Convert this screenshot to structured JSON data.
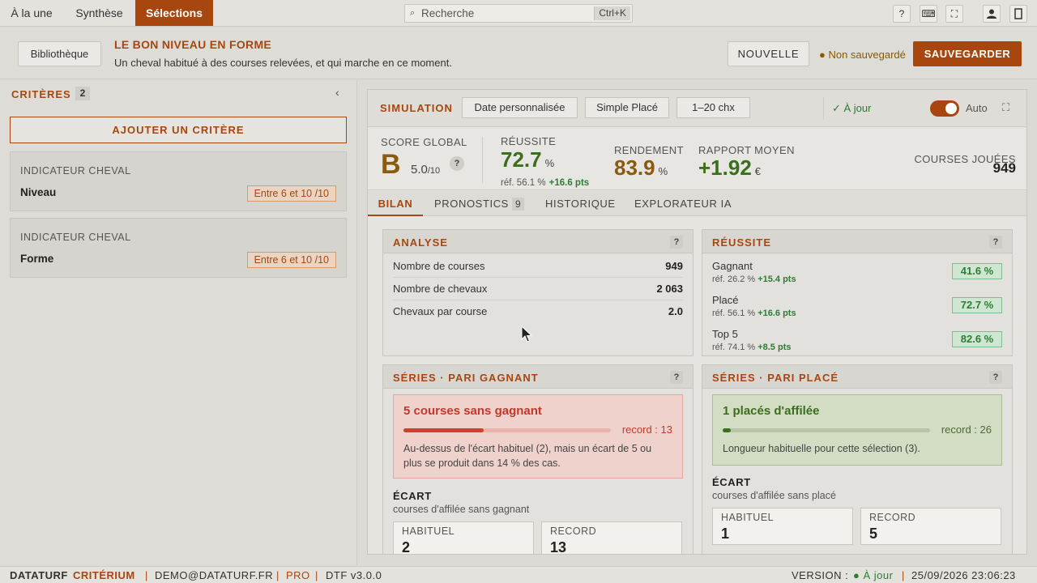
{
  "topbar": {
    "tabs": [
      {
        "label": "À la une"
      },
      {
        "label": "Synthèse"
      },
      {
        "label": "Sélections"
      }
    ],
    "search": {
      "placeholder": "Recherche",
      "shortcut": "Ctrl+K"
    },
    "icons": [
      "help-icon",
      "keyboard-icon",
      "fullscreen-icon",
      "user-icon",
      "panel-icon"
    ]
  },
  "header": {
    "library_label": "Bibliothèque",
    "title": "LE BON NIVEAU EN FORME",
    "description": "Un cheval habitué à des courses relevées, et qui marche en ce moment.",
    "new_label": "NOUVELLE",
    "unsaved": "● Non sauvegardé",
    "save_label": "SAUVEGARDER"
  },
  "sidebar": {
    "title": "CRITÈRES",
    "count": "2",
    "add_label": "AJOUTER UN CRITÈRE",
    "criteria": [
      {
        "category": "INDICATEUR CHEVAL",
        "name": "Niveau",
        "range": "Entre 6 et 10 /10"
      },
      {
        "category": "INDICATEUR CHEVAL",
        "name": "Forme",
        "range": "Entre 6 et 10 /10"
      }
    ]
  },
  "simulation": {
    "label": "SIMULATION",
    "date_label": "Date personnalisée",
    "bet_label": "Simple Placé",
    "runners_label": "1–20 chx",
    "status": "✓ À jour",
    "auto_label": "Auto",
    "auto_on": true
  },
  "scores": {
    "global_label": "SCORE GLOBAL",
    "grade": "B",
    "grade_value": "5.0",
    "grade_max": "/10",
    "reussite_label": "RÉUSSITE",
    "reussite_value": "72.7",
    "reussite_unit": "%",
    "reussite_ref": "réf. 56.1 %",
    "reussite_delta": "+16.6 pts",
    "rendement_label": "RENDEMENT",
    "rendement_value": "83.9",
    "rendement_unit": "%",
    "rapport_label": "RAPPORT MOYEN",
    "rapport_value": "+1.92",
    "rapport_unit": "€",
    "courses_label": "COURSES JOUÉES",
    "courses_value": "949"
  },
  "tabs": [
    {
      "label": "BILAN"
    },
    {
      "label": "PRONOSTICS",
      "badge": "9"
    },
    {
      "label": "HISTORIQUE"
    },
    {
      "label": "EXPLORATEUR IA"
    }
  ],
  "analyse": {
    "title": "ANALYSE",
    "rows": [
      {
        "label": "Nombre de courses",
        "value": "949"
      },
      {
        "label": "Nombre de chevaux",
        "value": "2 063"
      },
      {
        "label": "Chevaux par course",
        "value": "2.0"
      }
    ]
  },
  "reussite": {
    "title": "RÉUSSITE",
    "rows": [
      {
        "label": "Gagnant",
        "ref": "réf. 26.2 %",
        "delta": "+15.4 pts",
        "value": "41.6 %"
      },
      {
        "label": "Placé",
        "ref": "réf. 56.1 %",
        "delta": "+16.6 pts",
        "value": "72.7 %"
      },
      {
        "label": "Top 5",
        "ref": "réf. 74.1 %",
        "delta": "+8.5 pts",
        "value": "82.6 %"
      }
    ]
  },
  "series_gagnant": {
    "title": "SÉRIES · PARI GAGNANT",
    "alert_title": "5 courses sans gagnant",
    "progress": 0.385,
    "record": "record : 13",
    "text": "Au-dessus de l'écart habituel (2), mais un écart de 5 ou plus se produit dans 14 % des cas.",
    "ecart_label": "ÉCART",
    "ecart_sub": "courses d'affilée sans gagnant",
    "habituel_label": "HABITUEL",
    "habituel_value": "2",
    "record_label": "RECORD",
    "record_value": "13"
  },
  "series_place": {
    "title": "SÉRIES · PARI PLACÉ",
    "alert_title": "1 placés d'affilée",
    "progress": 0.038,
    "record": "record : 26",
    "text": "Longueur habituelle pour cette sélection (3).",
    "ecart_label": "ÉCART",
    "ecart_sub": "courses d'affilée sans placé",
    "habituel_label": "HABITUEL",
    "habituel_value": "1",
    "record_label": "RECORD",
    "record_value": "5"
  },
  "statusbar": {
    "brand1": "DATATURF",
    "brand2": "CRITÉRIUM",
    "email": "DEMO@DATATURF.FR",
    "plan": "PRO",
    "version_app": "DTF v3.0.0",
    "version_label": "VERSION :",
    "version_status": "● À jour",
    "datetime": "25/09/2026 23:06:23"
  }
}
